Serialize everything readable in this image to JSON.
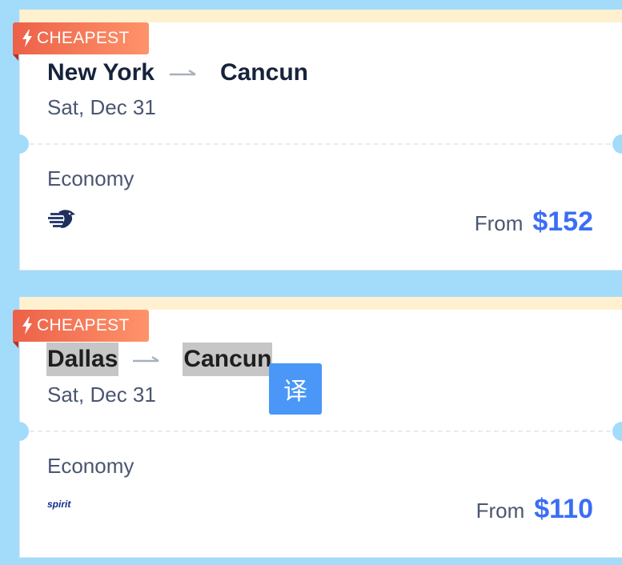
{
  "flights": [
    {
      "badge": "CHEAPEST",
      "origin": "New York",
      "destination": "Cancun",
      "date": "Sat, Dec 31",
      "cabin": "Economy",
      "airline_logo": "aeromexico-eagle-logo",
      "from_label": "From",
      "price": "$152"
    },
    {
      "badge": "CHEAPEST",
      "origin": "Dallas",
      "destination": "Cancun",
      "date": "Sat, Dec 31",
      "cabin": "Economy",
      "airline_logo": "spirit-logo",
      "airline_logo_text": "spirit",
      "from_label": "From",
      "price": "$110"
    }
  ],
  "translate_button": {
    "label": "译"
  },
  "colors": {
    "background": "#a3dcfb",
    "badge_start": "#ec6148",
    "badge_end": "#ff936a",
    "price": "#3b6ef5",
    "title": "#16233b",
    "top_strip": "#fff1d0",
    "translate_button": "#4a97f7"
  }
}
